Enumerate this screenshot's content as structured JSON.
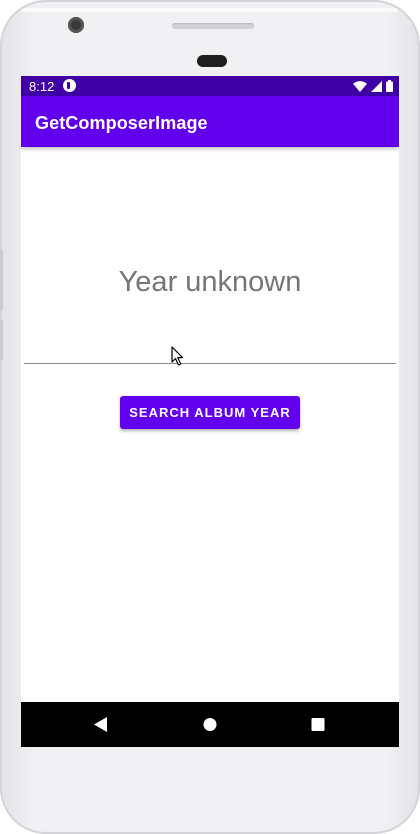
{
  "status_bar": {
    "time": "8:12",
    "app_icon": "notification-app-icon",
    "icons": [
      "wifi-icon",
      "signal-icon",
      "battery-icon"
    ],
    "color": "#3f00a6"
  },
  "app_bar": {
    "title": "GetComposerImage",
    "color": "#6200ee"
  },
  "main": {
    "year_text": "Year unknown",
    "input_value": "",
    "search_button_label": "SEARCH ALBUM YEAR"
  },
  "nav_bar": {
    "buttons": [
      "back-icon",
      "home-icon",
      "recents-icon"
    ]
  },
  "colors": {
    "accent": "#6200ee",
    "status_bar": "#3f00a6",
    "secondary_text": "#757575"
  }
}
